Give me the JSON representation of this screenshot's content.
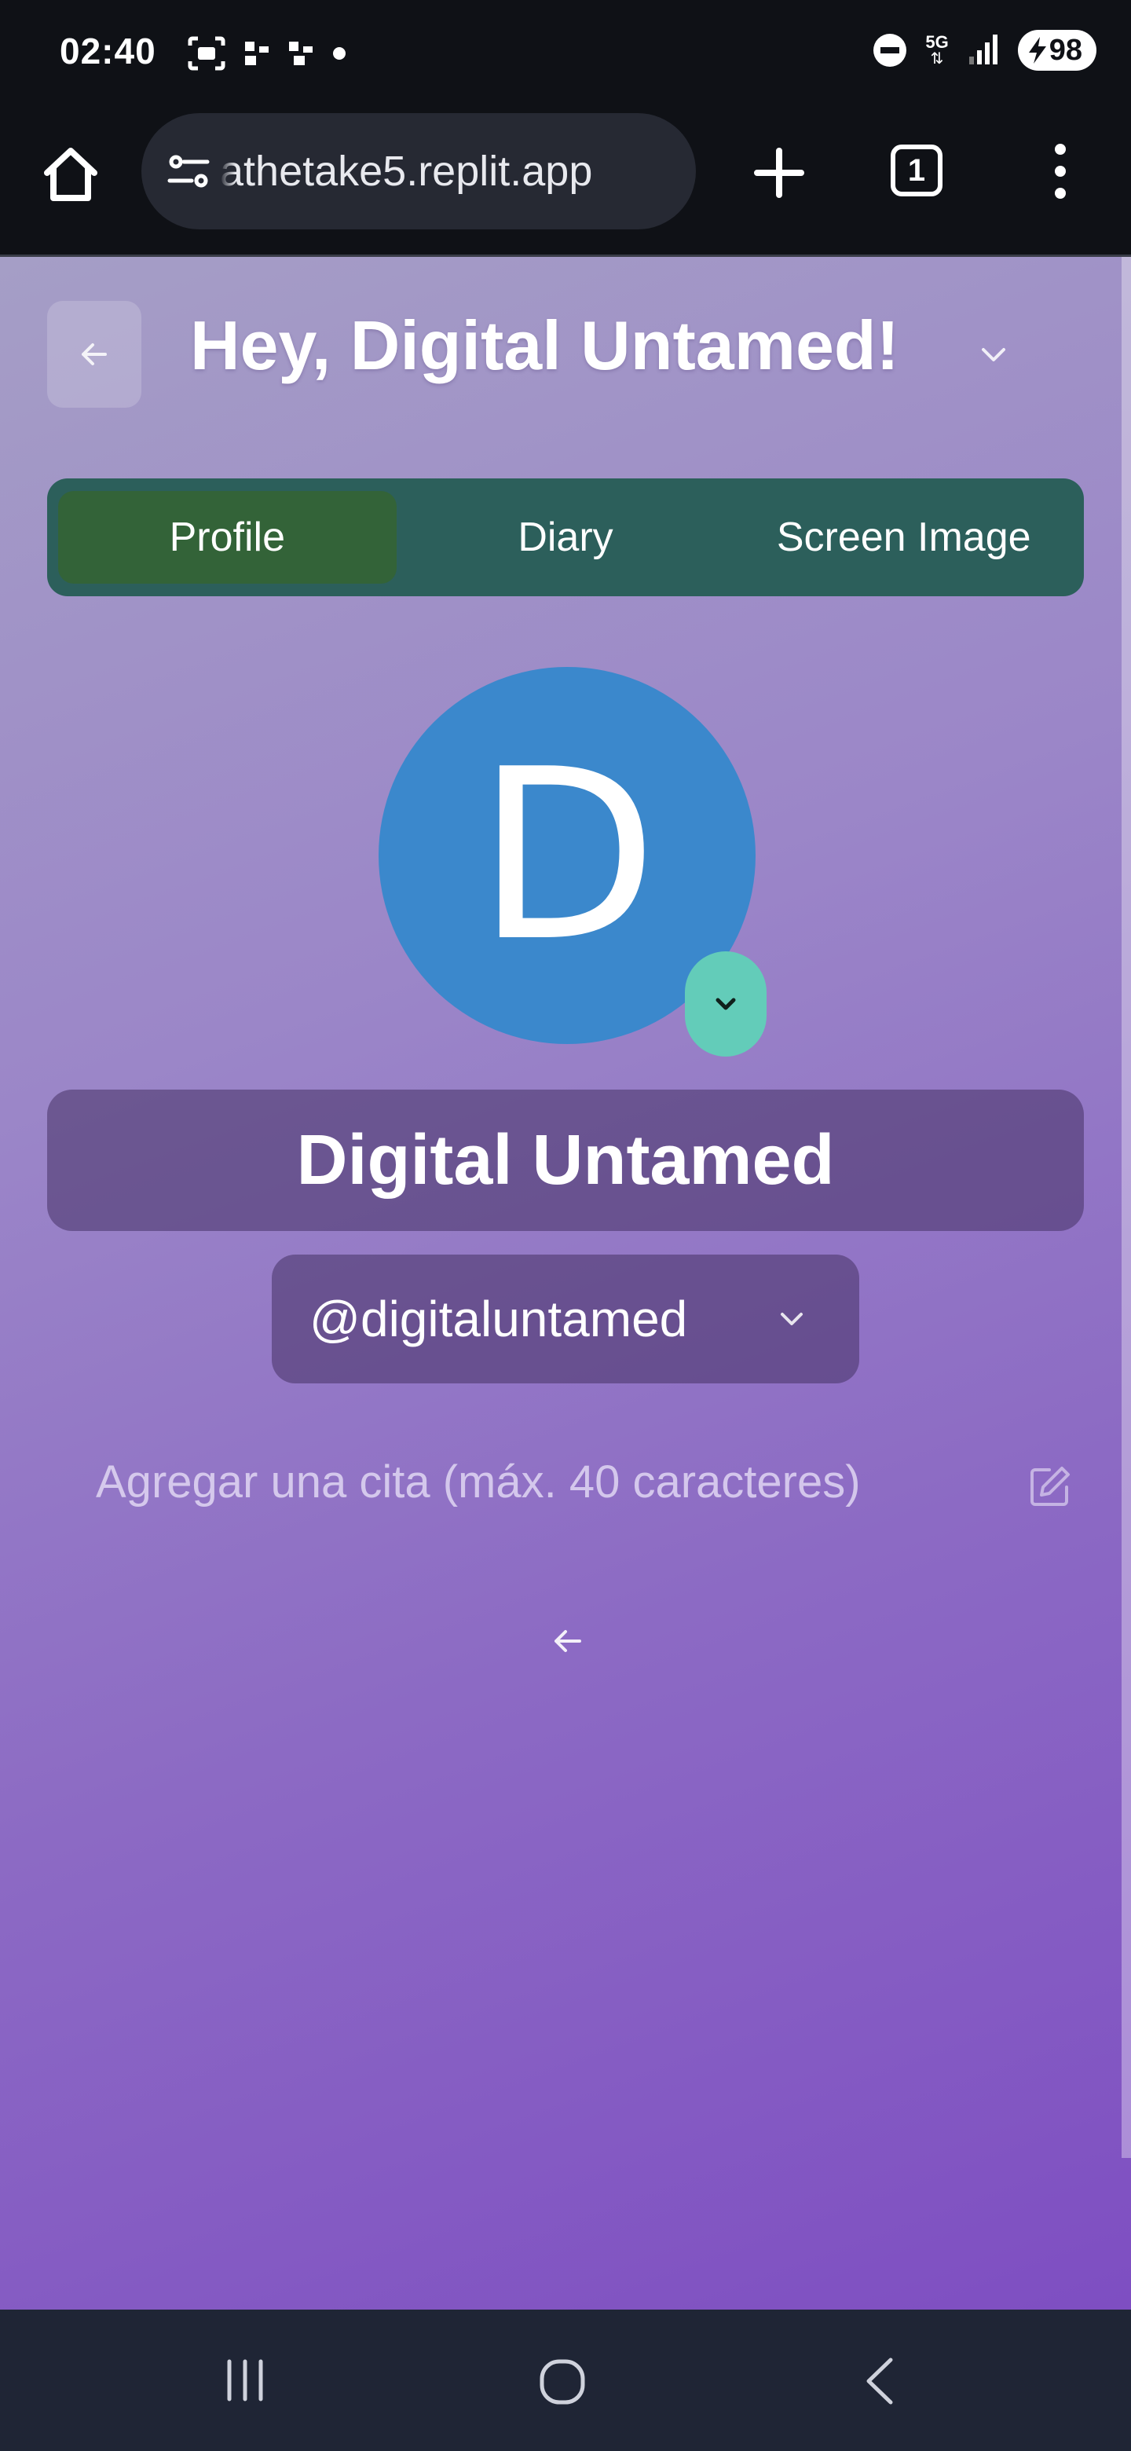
{
  "status_bar": {
    "time": "02:40",
    "network": "5G",
    "battery": "98"
  },
  "browser": {
    "url": "athetake5.replit.app",
    "tab_count": "1"
  },
  "header": {
    "greeting": "Hey, Digital Untamed!"
  },
  "tabs": [
    {
      "label": "Profile",
      "active": true
    },
    {
      "label": "Diary",
      "active": false
    },
    {
      "label": "Screen Image",
      "active": false
    }
  ],
  "profile": {
    "avatar_initial": "D",
    "display_name": "Digital Untamed",
    "handle": "@digitaluntamed",
    "quote_placeholder": "Agregar una cita (máx. 40 caracteres)"
  },
  "colors": {
    "tab_bar": "#2c5f5b",
    "tab_active": "#336338",
    "avatar_bg": "#3b88cc",
    "avatar_toggle": "#63ccb9",
    "nav_bar": "#1f2535"
  }
}
